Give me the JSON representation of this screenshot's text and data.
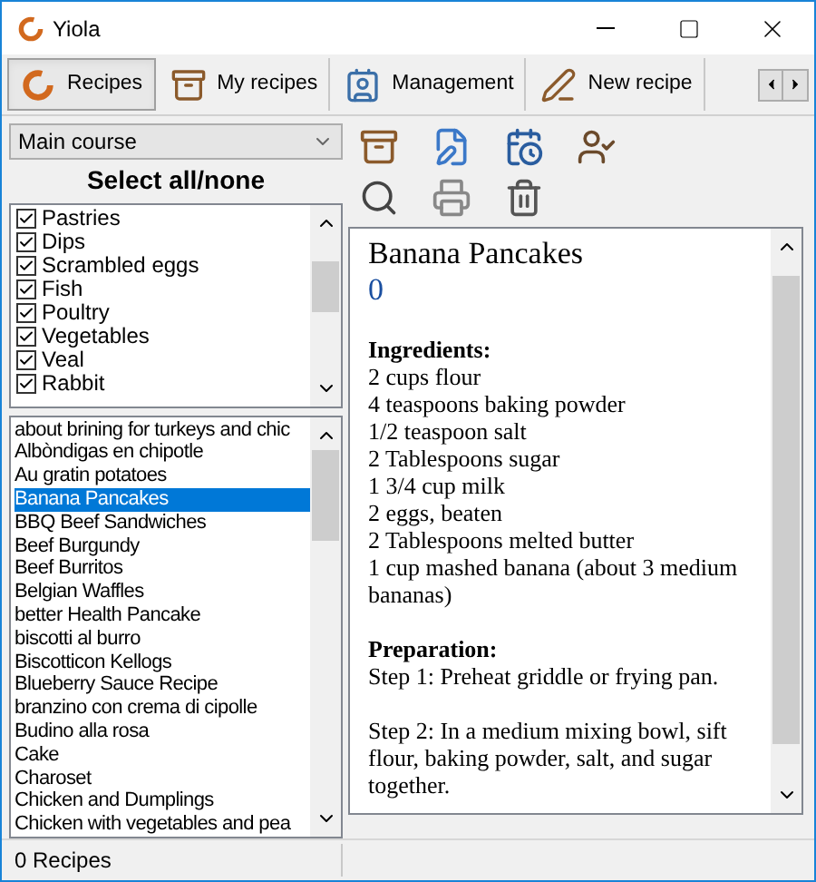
{
  "window": {
    "title": "Yiola"
  },
  "tabs": [
    {
      "label": "Recipes",
      "selected": true
    },
    {
      "label": "My recipes",
      "selected": false
    },
    {
      "label": "Management",
      "selected": false
    },
    {
      "label": "New recipe",
      "selected": false
    }
  ],
  "category": {
    "value": "Main course"
  },
  "select_all": "Select all/none",
  "categories": [
    {
      "label": "Pastries",
      "checked": true
    },
    {
      "label": "Dips",
      "checked": true
    },
    {
      "label": "Scrambled eggs",
      "checked": true
    },
    {
      "label": "Fish",
      "checked": true
    },
    {
      "label": "Poultry",
      "checked": true
    },
    {
      "label": "Vegetables",
      "checked": true
    },
    {
      "label": "Veal",
      "checked": true
    },
    {
      "label": "Rabbit",
      "checked": true
    }
  ],
  "recipes": [
    {
      "label": "about brining for turkeys and chic",
      "selected": false
    },
    {
      "label": "Albòndigas en chipotle",
      "selected": false
    },
    {
      "label": "Au gratin potatoes",
      "selected": false
    },
    {
      "label": "Banana Pancakes",
      "selected": true
    },
    {
      "label": "BBQ Beef Sandwiches",
      "selected": false
    },
    {
      "label": "Beef Burgundy",
      "selected": false
    },
    {
      "label": "Beef Burritos",
      "selected": false
    },
    {
      "label": "Belgian Waffles",
      "selected": false
    },
    {
      "label": "better Health Pancake",
      "selected": false
    },
    {
      "label": "biscotti al burro",
      "selected": false
    },
    {
      "label": "Biscotticon Kellogs",
      "selected": false
    },
    {
      "label": "Blueberry Sauce Recipe",
      "selected": false
    },
    {
      "label": "branzino con crema di cipolle",
      "selected": false
    },
    {
      "label": "Budino alla rosa",
      "selected": false
    },
    {
      "label": "Cake",
      "selected": false
    },
    {
      "label": "Charoset",
      "selected": false
    },
    {
      "label": "Chicken and Dumplings",
      "selected": false
    },
    {
      "label": "Chicken with vegetables and pea",
      "selected": false
    }
  ],
  "recipe": {
    "title": "Banana Pancakes",
    "rating": "0",
    "sections": [
      {
        "heading": "Ingredients:",
        "lines": [
          "2 cups flour",
          "4 teaspoons baking powder",
          "1/2 teaspoon salt",
          "2 Tablespoons sugar",
          "1 3/4 cup milk",
          "2 eggs, beaten",
          "2 Tablespoons melted butter",
          "1 cup mashed banana (about 3 medium bananas)"
        ]
      },
      {
        "heading": "Preparation:",
        "lines": [
          "Step 1: Preheat griddle or frying pan."
        ]
      },
      {
        "lines": [
          "Step 2: In a medium mixing bowl, sift flour, baking powder, salt, and sugar together."
        ]
      }
    ]
  },
  "status_bar": "0 Recipes"
}
